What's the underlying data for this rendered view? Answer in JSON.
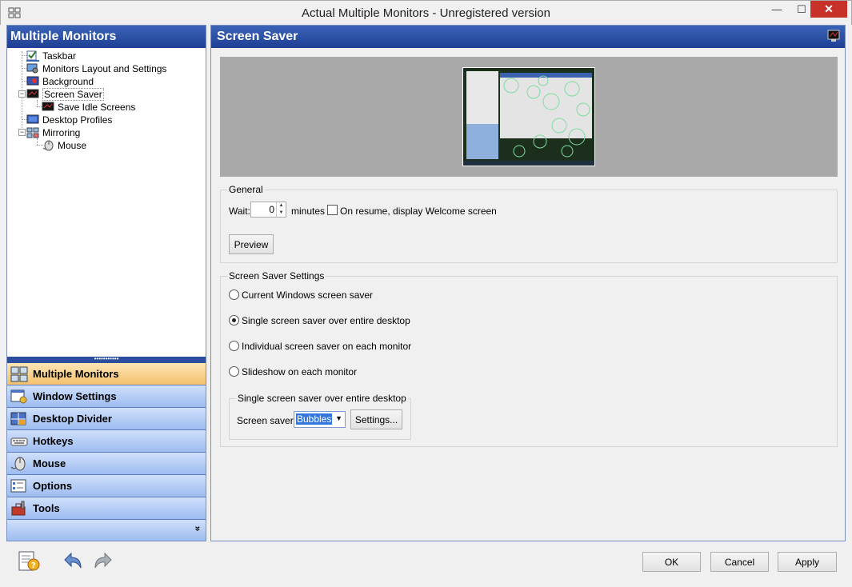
{
  "window": {
    "title": "Actual Multiple Monitors - Unregistered version",
    "min_glyph": "—",
    "max_glyph": "☐",
    "close_glyph": "✕"
  },
  "left_panel": {
    "header": "Multiple Monitors",
    "tree": [
      {
        "label": "Taskbar",
        "icon": "taskbar-checkbox-icon"
      },
      {
        "label": "Monitors Layout and Settings",
        "icon": "monitor-settings-icon"
      },
      {
        "label": "Background",
        "icon": "background-icon"
      },
      {
        "label": "Screen Saver",
        "icon": "screen-saver-icon",
        "selected": true,
        "expander": "−"
      },
      {
        "label": "Save Idle Screens",
        "icon": "save-idle-screens-icon"
      },
      {
        "label": "Desktop Profiles",
        "icon": "desktop-profiles-icon"
      },
      {
        "label": "Mirroring",
        "icon": "mirroring-icon",
        "expander": "−"
      },
      {
        "label": "Mouse",
        "icon": "mouse-icon"
      }
    ],
    "splitter_glyph": "•••••••••••",
    "nav": [
      {
        "label": "Multiple Monitors",
        "icon": "multiple-monitors-icon",
        "active": true
      },
      {
        "label": "Window Settings",
        "icon": "window-settings-icon"
      },
      {
        "label": "Desktop Divider",
        "icon": "desktop-divider-icon"
      },
      {
        "label": "Hotkeys",
        "icon": "hotkeys-icon"
      },
      {
        "label": "Mouse",
        "icon": "mouse-icon"
      },
      {
        "label": "Options",
        "icon": "options-icon"
      },
      {
        "label": "Tools",
        "icon": "tools-icon"
      }
    ],
    "more_glyph": "»"
  },
  "right_panel": {
    "header": "Screen Saver",
    "general": {
      "title": "General",
      "wait_label": "Wait:",
      "wait_value": "0",
      "minutes_label": "minutes",
      "resume_label": "On resume, display Welcome screen",
      "preview_button": "Preview"
    },
    "settings": {
      "title": "Screen Saver Settings",
      "options": [
        {
          "label": "Current Windows screen saver",
          "checked": false
        },
        {
          "label": "Single screen saver over entire desktop",
          "checked": true
        },
        {
          "label": "Individual screen saver on each monitor",
          "checked": false
        },
        {
          "label": "Slideshow on each monitor",
          "checked": false
        }
      ],
      "sub_group_title": "Single screen saver over entire desktop",
      "screen_saver_label": "Screen saver:",
      "screen_saver_value": "Bubbles",
      "settings_button": "Settings..."
    }
  },
  "footer": {
    "ok": "OK",
    "cancel": "Cancel",
    "apply": "Apply"
  },
  "colors": {
    "header_blue": "#1f3f93",
    "nav_active": "#f3c16c",
    "nav_inactive": "#9dbcf0",
    "close_red": "#c7312a"
  }
}
